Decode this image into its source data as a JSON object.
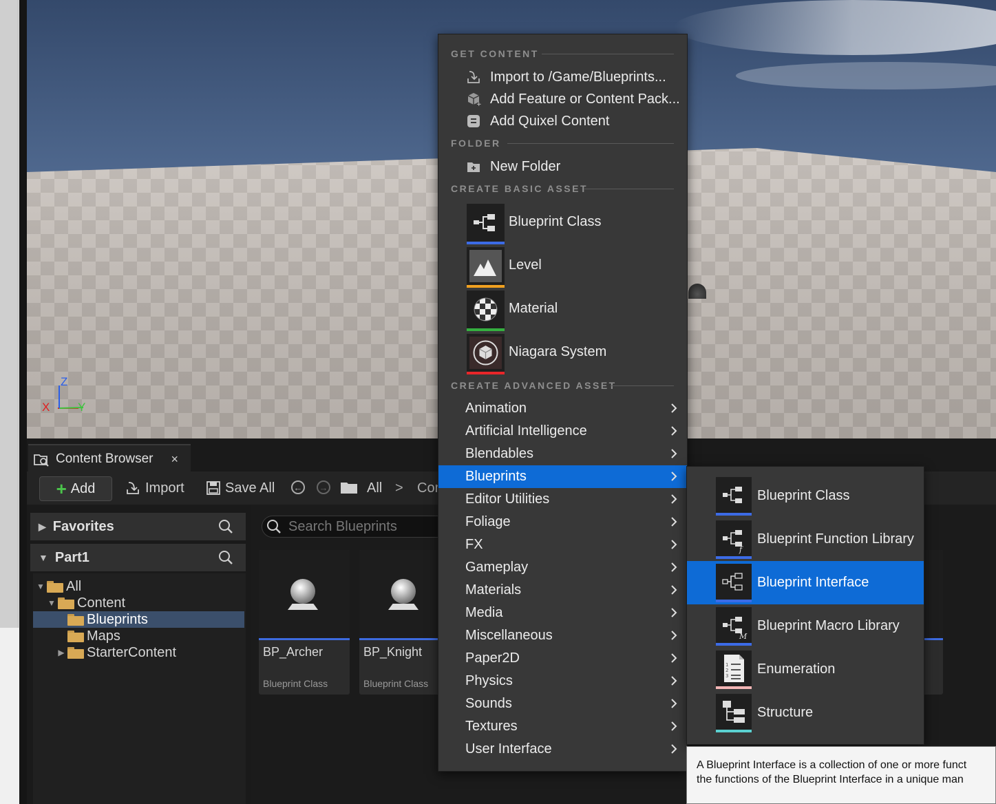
{
  "viewport": {
    "axis_labels": {
      "z": "Z",
      "x": "X",
      "y": "Y"
    },
    "colors": {
      "sky_top": "#33476a",
      "sky_bottom": "#7c93b4",
      "floor": "#c4bdb7",
      "x_axis": "#e02020",
      "y_axis": "#3ec43e",
      "z_axis": "#2a5ee8"
    }
  },
  "content_browser": {
    "tab_label": "Content Browser",
    "tab_close": "×",
    "toolbar": {
      "add_label": "Add",
      "import_label": "Import",
      "save_all_label": "Save All",
      "breadcrumb_all": "All",
      "breadcrumb_sep": ">",
      "breadcrumb_partial": "Cor"
    },
    "sidebar": {
      "favorites_label": "Favorites",
      "project_label": "Part1",
      "tree": [
        {
          "label": "All"
        },
        {
          "label": "Content"
        },
        {
          "label": "Blueprints"
        },
        {
          "label": "Maps"
        },
        {
          "label": "StarterContent"
        }
      ]
    },
    "search": {
      "placeholder": "Search Blueprints"
    },
    "assets": [
      {
        "name": "BP_Archer",
        "type": "Blueprint Class"
      },
      {
        "name": "BP_Knight",
        "type": "Blueprint Class"
      }
    ],
    "partial_tile_text": "s"
  },
  "context_menu": {
    "sections": {
      "get_content": "GET CONTENT",
      "folder": "FOLDER",
      "create_basic": "CREATE BASIC ASSET",
      "create_advanced": "CREATE ADVANCED ASSET"
    },
    "get_content_items": [
      {
        "label": "Import to /Game/Blueprints..."
      },
      {
        "label": "Add Feature or Content Pack..."
      },
      {
        "label": "Add Quixel Content"
      }
    ],
    "folder_items": [
      {
        "label": "New Folder"
      }
    ],
    "basic_assets": [
      {
        "label": "Blueprint Class",
        "color": "#3c6be6"
      },
      {
        "label": "Level",
        "color": "#f0a020"
      },
      {
        "label": "Material",
        "color": "#35b040"
      },
      {
        "label": "Niagara System",
        "color": "#e8262a"
      }
    ],
    "advanced_items": [
      {
        "label": "Animation"
      },
      {
        "label": "Artificial Intelligence"
      },
      {
        "label": "Blendables"
      },
      {
        "label": "Blueprints"
      },
      {
        "label": "Editor Utilities"
      },
      {
        "label": "Foliage"
      },
      {
        "label": "FX"
      },
      {
        "label": "Gameplay"
      },
      {
        "label": "Materials"
      },
      {
        "label": "Media"
      },
      {
        "label": "Miscellaneous"
      },
      {
        "label": "Paper2D"
      },
      {
        "label": "Physics"
      },
      {
        "label": "Sounds"
      },
      {
        "label": "Textures"
      },
      {
        "label": "User Interface"
      }
    ],
    "highlight_color": "#0e6bd6"
  },
  "submenu": {
    "items": [
      {
        "label": "Blueprint Class",
        "color": "#3c6be6",
        "glyph": ""
      },
      {
        "label": "Blueprint Function Library",
        "color": "#3c6be6",
        "glyph": "f"
      },
      {
        "label": "Blueprint Interface",
        "color": "#3c6be6",
        "glyph": ""
      },
      {
        "label": "Blueprint Macro Library",
        "color": "#3c6be6",
        "glyph": "M"
      },
      {
        "label": "Enumeration",
        "color": "#f2b5b5",
        "glyph": ""
      },
      {
        "label": "Structure",
        "color": "#5ad0d0",
        "glyph": ""
      }
    ]
  },
  "tooltip": {
    "line1": "A Blueprint Interface is a collection of one or more funct",
    "line2": "the functions of the Blueprint Interface in a unique man"
  }
}
